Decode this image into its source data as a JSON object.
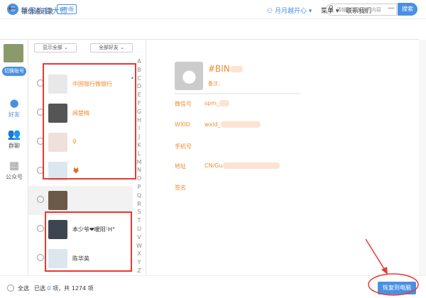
{
  "app": {
    "name": "苹果恢复大师",
    "badge": "Win版",
    "user": "月月越开心 ▾",
    "menu": "菜单 ▾",
    "contact": "联系我们",
    "minimize": "—",
    "close": "✕"
  },
  "nav": {
    "back": "←",
    "title": "微信通讯录",
    "search_placeholder": "请输入要查找的内容",
    "search_button": "搜索"
  },
  "sidebar": {
    "switch_account": "切换账号",
    "items": [
      {
        "label": "好友",
        "icon": "person-icon",
        "active": true
      },
      {
        "label": "群聊",
        "icon": "group-icon"
      },
      {
        "label": "公众号",
        "icon": "grid-icon"
      }
    ]
  },
  "filters": {
    "show": "显示全部",
    "friends": "全部好友"
  },
  "contacts": [
    {
      "name": "中国银行微银行",
      "orange": true,
      "avatar": "#e8e8e8"
    },
    {
      "name": "闻楚梅",
      "orange": true,
      "avatar": "#555"
    },
    {
      "name": "♀",
      "orange": true,
      "avatar": "#f0e0dc"
    },
    {
      "name": "🦊",
      "orange": true,
      "avatar": "#dce6ee"
    },
    {
      "name": "",
      "orange": false,
      "avatar": "#6b5a4a"
    },
    {
      "name": "本少爷❤暖阳ᵕ̈H°",
      "orange": false,
      "avatar": "#3d4650"
    },
    {
      "name": "陈华英",
      "orange": false,
      "avatar": "#dce6ee"
    }
  ],
  "alphabet": [
    "A",
    "B",
    "C",
    "D",
    "E",
    "F",
    "G",
    "H",
    "I",
    "J",
    "K",
    "L",
    "M",
    "N",
    "O",
    "P",
    "Q",
    "R",
    "S",
    "T",
    "U",
    "V",
    "W",
    "X",
    "Y",
    "Z"
  ],
  "detail": {
    "name": "#BIN",
    "remark_label": "备注：",
    "fields": [
      {
        "label": "微信号",
        "value": "spm_"
      },
      {
        "label": "WXID",
        "value": "wxid_"
      },
      {
        "label": "手机号",
        "value": ""
      },
      {
        "label": "地址",
        "value": "CN/Gu"
      },
      {
        "label": "签名",
        "value": ""
      }
    ]
  },
  "footer": {
    "select_all": "全选",
    "selected_prefix": "已选",
    "selected_count": "0",
    "selected_suffix": "项，共 1274 项",
    "restore_button": "恢复到电脑"
  },
  "colors": {
    "accent": "#4a90e2",
    "orange": "#f08a2c",
    "annotation": "#e53935"
  }
}
